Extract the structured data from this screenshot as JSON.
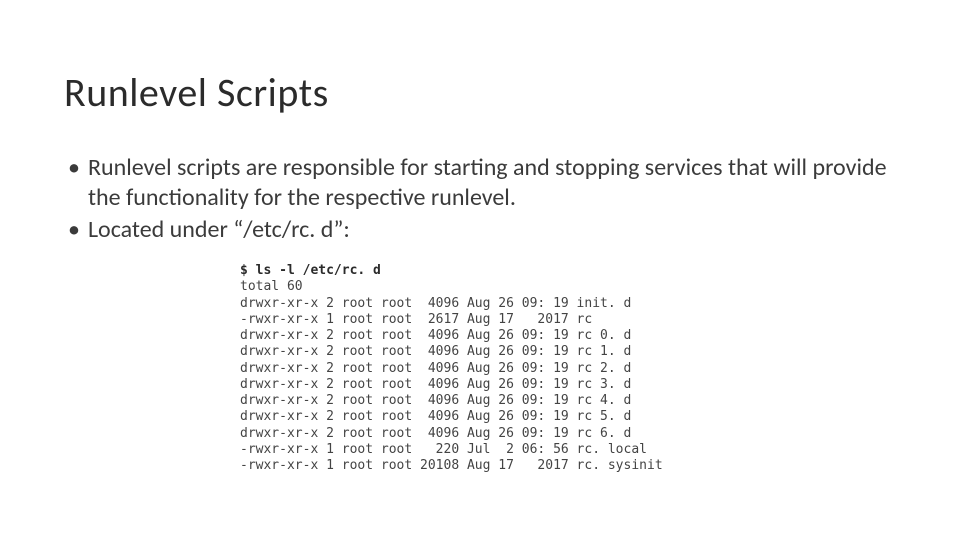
{
  "title": "Runlevel Scripts",
  "bullets": [
    "Runlevel scripts are responsible for starting and stopping services that will provide the functionality for the respective runlevel.",
    "Located under “/etc/rc. d”:"
  ],
  "code": {
    "command": "$ ls -l /etc/rc. d",
    "total": "total 60",
    "entries": [
      {
        "perms": "drwxr-xr-x",
        "links": "2",
        "owner": "root",
        "group": "root",
        "size": "4096",
        "month": "Aug",
        "day": "26",
        "time": "09: 19",
        "name": "init. d"
      },
      {
        "perms": "-rwxr-xr-x",
        "links": "1",
        "owner": "root",
        "group": "root",
        "size": "2617",
        "month": "Aug",
        "day": "17",
        "time": "2017",
        "name": "rc"
      },
      {
        "perms": "drwxr-xr-x",
        "links": "2",
        "owner": "root",
        "group": "root",
        "size": "4096",
        "month": "Aug",
        "day": "26",
        "time": "09: 19",
        "name": "rc 0. d"
      },
      {
        "perms": "drwxr-xr-x",
        "links": "2",
        "owner": "root",
        "group": "root",
        "size": "4096",
        "month": "Aug",
        "day": "26",
        "time": "09: 19",
        "name": "rc 1. d"
      },
      {
        "perms": "drwxr-xr-x",
        "links": "2",
        "owner": "root",
        "group": "root",
        "size": "4096",
        "month": "Aug",
        "day": "26",
        "time": "09: 19",
        "name": "rc 2. d"
      },
      {
        "perms": "drwxr-xr-x",
        "links": "2",
        "owner": "root",
        "group": "root",
        "size": "4096",
        "month": "Aug",
        "day": "26",
        "time": "09: 19",
        "name": "rc 3. d"
      },
      {
        "perms": "drwxr-xr-x",
        "links": "2",
        "owner": "root",
        "group": "root",
        "size": "4096",
        "month": "Aug",
        "day": "26",
        "time": "09: 19",
        "name": "rc 4. d"
      },
      {
        "perms": "drwxr-xr-x",
        "links": "2",
        "owner": "root",
        "group": "root",
        "size": "4096",
        "month": "Aug",
        "day": "26",
        "time": "09: 19",
        "name": "rc 5. d"
      },
      {
        "perms": "drwxr-xr-x",
        "links": "2",
        "owner": "root",
        "group": "root",
        "size": "4096",
        "month": "Aug",
        "day": "26",
        "time": "09: 19",
        "name": "rc 6. d"
      },
      {
        "perms": "-rwxr-xr-x",
        "links": "1",
        "owner": "root",
        "group": "root",
        "size": "220",
        "month": "Jul",
        "day": "2",
        "time": "06: 56",
        "name": "rc. local"
      },
      {
        "perms": "-rwxr-xr-x",
        "links": "1",
        "owner": "root",
        "group": "root",
        "size": "20108",
        "month": "Aug",
        "day": "17",
        "time": "2017",
        "name": "rc. sysinit"
      }
    ]
  }
}
